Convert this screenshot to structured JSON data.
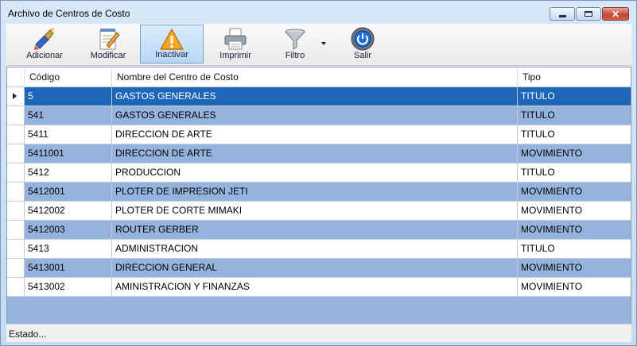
{
  "window": {
    "title": "Archivo de Centros de Costo"
  },
  "toolbar": {
    "buttons": [
      {
        "label": "Adicionar",
        "icon": "brush-add-icon"
      },
      {
        "label": "Modificar",
        "icon": "edit-notepad-icon"
      },
      {
        "label": "Inactivar",
        "icon": "warning-icon"
      },
      {
        "label": "Imprimir",
        "icon": "printer-icon"
      },
      {
        "label": "Filtro",
        "icon": "funnel-filter-icon"
      },
      {
        "label": "Salir",
        "icon": "power-icon"
      }
    ]
  },
  "grid": {
    "columns": [
      "Código",
      "Nombre del Centro de Costo",
      "Tipo"
    ],
    "rows": [
      {
        "codigo": "5",
        "nombre": "GASTOS GENERALES",
        "tipo": "TITULO"
      },
      {
        "codigo": "541",
        "nombre": "GASTOS GENERALES",
        "tipo": "TITULO"
      },
      {
        "codigo": "5411",
        "nombre": "DIRECCION DE ARTE",
        "tipo": "TITULO"
      },
      {
        "codigo": "5411001",
        "nombre": "DIRECCION DE ARTE",
        "tipo": "MOVIMIENTO"
      },
      {
        "codigo": "5412",
        "nombre": "PRODUCCION",
        "tipo": "TITULO"
      },
      {
        "codigo": "5412001",
        "nombre": "PLOTER DE IMPRESION JETI",
        "tipo": "MOVIMIENTO"
      },
      {
        "codigo": "5412002",
        "nombre": "PLOTER DE CORTE MIMAKI",
        "tipo": "MOVIMIENTO"
      },
      {
        "codigo": "5412003",
        "nombre": "ROUTER GERBER",
        "tipo": "MOVIMIENTO"
      },
      {
        "codigo": "5413",
        "nombre": "ADMINISTRACION",
        "tipo": "TITULO"
      },
      {
        "codigo": "5413001",
        "nombre": "DIRECCION GENERAL",
        "tipo": "MOVIMIENTO"
      },
      {
        "codigo": "5413002",
        "nombre": "AMINISTRACION Y FINANZAS",
        "tipo": "MOVIMIENTO"
      }
    ]
  },
  "statusbar": {
    "text": "Estado..."
  },
  "colors": {
    "selected_row": "#1e67b8",
    "alt_row": "#94b4de",
    "window_bg": "#c9dff5"
  }
}
